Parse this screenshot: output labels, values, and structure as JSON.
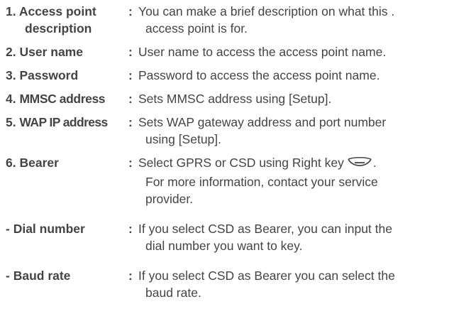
{
  "entries": [
    {
      "number": "1.",
      "term_line1": "Access point",
      "term_line2": "description",
      "separator": ":",
      "def_line1": "You can make a brief description on what this .",
      "def_line2": "access point is for."
    },
    {
      "number": "2.",
      "term_line1": "User name",
      "separator": ":",
      "def_line1": "User name to access the access point name."
    },
    {
      "number": "3.",
      "term_line1": "Password",
      "separator": ":",
      "def_line1": "Password to access the access point name."
    },
    {
      "number": "4.",
      "term_line1": "MMSC address",
      "separator": ":",
      "def_line1": "Sets MMSC address using [Setup]."
    },
    {
      "number": "5.",
      "term_line1": "WAP IP address",
      "separator": ":",
      "def_line1": "Sets WAP gateway address and port number",
      "def_line2": "using [Setup]."
    },
    {
      "number": "6.",
      "term_line1": "Bearer",
      "separator": ":",
      "def_line1_pre": "Select GPRS or CSD using Right key",
      "def_line1_post": ".",
      "def_line2": "For more information, contact your service",
      "def_line3": "provider."
    },
    {
      "number": "-",
      "term_line1": "Dial number",
      "separator": ":",
      "def_line1": "If you select CSD as Bearer, you can input the",
      "def_line2": "dial number you want to key."
    },
    {
      "number": "-",
      "term_line1": "Baud rate",
      "separator": ":",
      "def_line1": "If you select CSD as Bearer you can select the",
      "def_line2": "baud rate."
    }
  ],
  "icons": {
    "right_key": "right-soft-key-icon"
  }
}
